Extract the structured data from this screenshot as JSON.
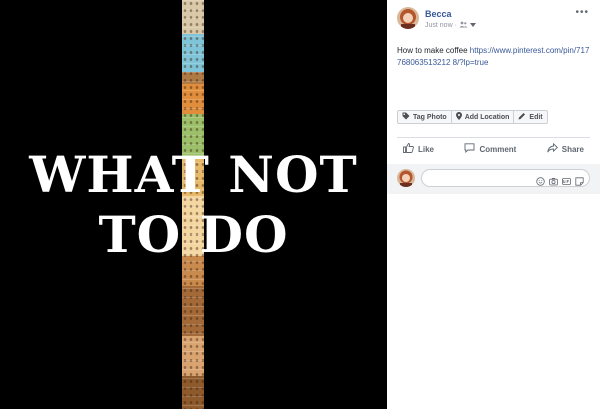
{
  "photo": {
    "overlay_line1": "WHAT NOT",
    "overlay_line2": "TO DO"
  },
  "post": {
    "author": "Becca",
    "timestamp": "Just now",
    "audience_icon": "friends-icon",
    "text": "How to make coffee ",
    "link": "https://www.pinterest.com/pin/717768063513212 8/?lp=true"
  },
  "photo_actions": {
    "tag_photo": "Tag Photo",
    "add_location": "Add Location",
    "edit": "Edit"
  },
  "reactions": {
    "like": "Like",
    "comment": "Comment",
    "share": "Share"
  },
  "comment_box": {
    "icons": [
      "emoji-icon",
      "camera-icon",
      "gif-icon",
      "sticker-icon"
    ]
  },
  "colors": {
    "brand_link": "#385898",
    "viewer_bg": "#000000"
  }
}
